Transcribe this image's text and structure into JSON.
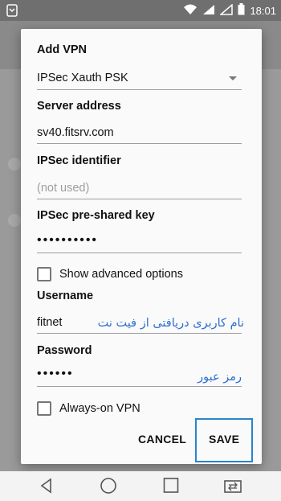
{
  "status": {
    "time": "18:01"
  },
  "dialog": {
    "title": "Add VPN",
    "vpn_type": "IPSec Xauth PSK",
    "server_address_label": "Server address",
    "server_address_value": "sv40.fitsrv.com",
    "ipsec_identifier_label": "IPSec identifier",
    "ipsec_identifier_placeholder": "(not used)",
    "psk_label": "IPSec pre-shared key",
    "psk_value": "••••••••••",
    "advanced_label": "Show advanced options",
    "username_label": "Username",
    "username_value": "fitnet",
    "username_annotation": "نام کاربری دریافتی از فیت نت",
    "password_label": "Password",
    "password_value": "••••••",
    "password_annotation": "رمز عبور",
    "always_on_label": "Always-on VPN",
    "cancel_label": "CANCEL",
    "save_label": "SAVE"
  },
  "colors": {
    "highlight": "#2b84c8",
    "annotation": "#2f6fd0"
  },
  "icons": {
    "status_left": "app-icon",
    "wifi": "wifi-icon",
    "signal": "signal-icon",
    "battery": "battery-icon",
    "back": "back-icon",
    "home": "home-icon",
    "recents": "recents-icon",
    "switch_sim": "switch-icon"
  }
}
